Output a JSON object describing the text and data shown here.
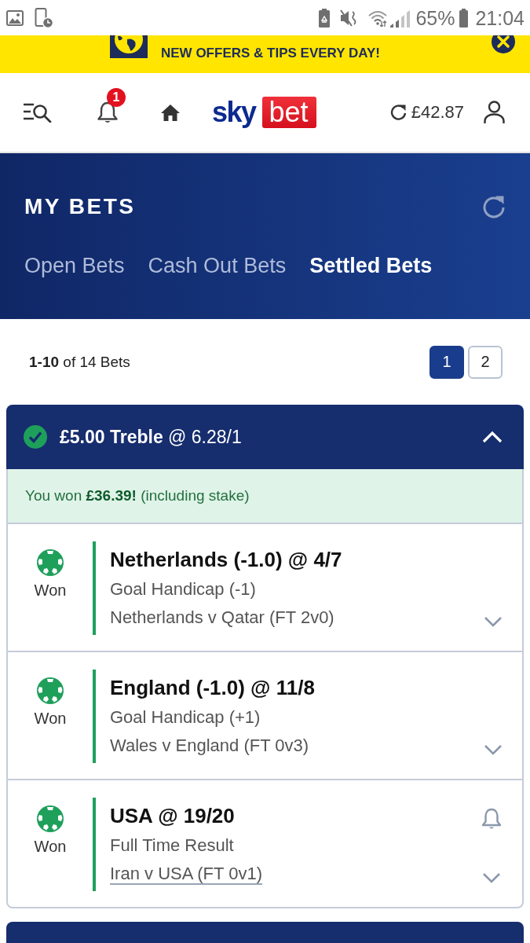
{
  "status_bar": {
    "battery": "65%",
    "time": "21:04"
  },
  "promo_banner": {
    "text": "NEW OFFERS & TIPS EVERY DAY!"
  },
  "header": {
    "notification_count": "1",
    "logo": {
      "text": "sky",
      "tile_text": "bet"
    },
    "balance": "£42.87"
  },
  "page_header": {
    "title": "MY BETS",
    "tabs": [
      {
        "label": "Open Bets",
        "selected": false
      },
      {
        "label": "Cash Out Bets",
        "selected": false
      },
      {
        "label": "Settled Bets",
        "selected": true
      }
    ]
  },
  "pagination": {
    "summary": "**1-10** of 14 Bets",
    "pages": [
      {
        "label": "1",
        "selected": true
      },
      {
        "label": "2",
        "selected": false
      }
    ]
  },
  "bet": {
    "title": "**£5.00 Treble** @ 6.28/1",
    "won": true,
    "expanded": true,
    "result_message": "You won **£36.39!** (including stake)",
    "selections": [
      {
        "result": "Won",
        "won": true,
        "selection": "Netherlands (-1.0) @ 4/7",
        "market": "Goal Handicap (-1)",
        "event": "Netherlands v Qatar (FT 2v0)",
        "event_linked": false,
        "alert_available": false
      },
      {
        "result": "Won",
        "won": true,
        "selection": "England (-1.0) @ 11/8",
        "market": "Goal Handicap (+1)",
        "event": "Wales v England (FT 0v3)",
        "event_linked": false,
        "alert_available": false
      },
      {
        "result": "Won",
        "won": true,
        "selection": "USA @ 19/20",
        "market": "Full Time Result",
        "event": "Iran v USA (FT 0v1)",
        "event_linked": true,
        "alert_available": true
      }
    ]
  }
}
